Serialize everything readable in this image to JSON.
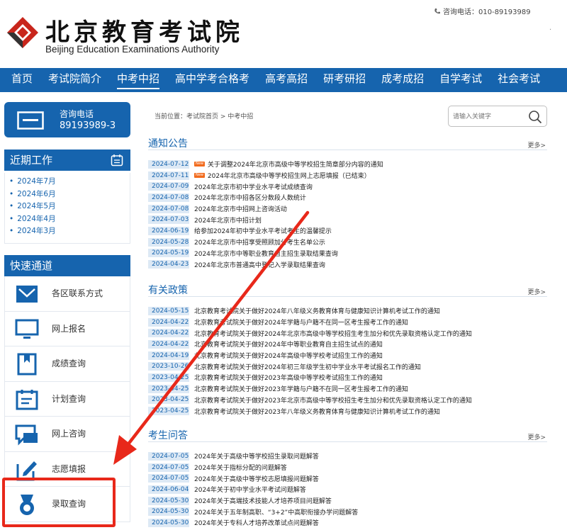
{
  "header": {
    "logo_cn": "北京教育考试院",
    "logo_en": "Beijing Education Examinations Authority",
    "hotline": "咨询电话：010-89193989",
    "dot": "."
  },
  "nav": {
    "items": [
      "首页",
      "考试院简介",
      "中考中招",
      "高中学考合格考",
      "高考高招",
      "研考研招",
      "成考成招",
      "自学考试",
      "社会考试"
    ],
    "active": "中考中招"
  },
  "sidebar": {
    "hotline_label": "咨询电话",
    "hotline_number": "89193989-3",
    "recent_title": "近期工作",
    "recent_items": [
      "2024年7月",
      "2024年6月",
      "2024年5月",
      "2024年4月",
      "2024年3月"
    ],
    "quick_title": "快速通道",
    "quick_items": [
      {
        "label": "各区联系方式",
        "icon": "envelope-icon"
      },
      {
        "label": "网上报名",
        "icon": "monitor-icon"
      },
      {
        "label": "成绩查询",
        "icon": "bookmark-icon"
      },
      {
        "label": "计划查询",
        "icon": "calendar-icon"
      },
      {
        "label": "网上咨询",
        "icon": "chat-icon"
      },
      {
        "label": "志愿填报",
        "icon": "edit-icon"
      },
      {
        "label": "录取查询",
        "icon": "medal-icon"
      }
    ]
  },
  "main": {
    "breadcrumb": "当前位置：考试院首页 > 中考中招",
    "search_placeholder": "请输入关键字",
    "more_label": "更多>",
    "new_badge": "New",
    "sections": [
      {
        "title": "通知公告",
        "items": [
          {
            "date": "2024-07-12",
            "new": true,
            "title": "关于调整2024年北京市高级中等学校招生简章部分内容的通知"
          },
          {
            "date": "2024-07-11",
            "new": true,
            "title": "2024年北京市高级中等学校招生网上志愿填报（已结束）"
          },
          {
            "date": "2024-07-09",
            "new": false,
            "title": "2024年北京市初中学业水平考试成绩查询"
          },
          {
            "date": "2024-07-08",
            "new": false,
            "title": "2024年北京市中招各区分数段人数统计"
          },
          {
            "date": "2024-07-08",
            "new": false,
            "title": "2024年北京市中招网上咨询活动"
          },
          {
            "date": "2024-07-03",
            "new": false,
            "title": "2024年北京市中招计划"
          },
          {
            "date": "2024-06-19",
            "new": false,
            "title": "给参加2024年初中学业水平考试考生的温馨提示"
          },
          {
            "date": "2024-05-28",
            "new": false,
            "title": "2024年北京市中招享受照顾加分考生名单公示"
          },
          {
            "date": "2024-05-19",
            "new": false,
            "title": "2024年北京市中等职业教育自主招生录取结果查询"
          },
          {
            "date": "2024-04-23",
            "new": false,
            "title": "2024年北京市普通高中登记入学录取结果查询"
          }
        ]
      },
      {
        "title": "有关政策",
        "items": [
          {
            "date": "2024-05-15",
            "new": false,
            "title": "北京教育考试院关于做好2024年八年级义务教育体育与健康知识计算机考试工作的通知"
          },
          {
            "date": "2024-04-22",
            "new": false,
            "title": "北京教育考试院关于做好2024年学籍与户籍不在同一区考生报考工作的通知"
          },
          {
            "date": "2024-04-22",
            "new": false,
            "title": "北京教育考试院关于做好2024年北京市高级中等学校招生考生加分和优先录取资格认定工作的通知"
          },
          {
            "date": "2024-04-22",
            "new": false,
            "title": "北京教育考试院关于做好2024年中等职业教育自主招生试点的通知"
          },
          {
            "date": "2024-04-19",
            "new": false,
            "title": "北京教育考试院关于做好2024年高级中等学校考试招生工作的通知"
          },
          {
            "date": "2023-10-26",
            "new": false,
            "title": "北京教育考试院关于做好2024年初三年级学生初中学业水平考试报名工作的通知"
          },
          {
            "date": "2023-04-25",
            "new": false,
            "title": "北京教育考试院关于做好2023年高级中等学校考试招生工作的通知"
          },
          {
            "date": "2023-04-25",
            "new": false,
            "title": "北京教育考试院关于做好2023年学籍与户籍不在同一区考生报考工作的通知"
          },
          {
            "date": "2023-04-25",
            "new": false,
            "title": "北京教育考试院关于做好2023年北京市高级中等学校招生考生加分和优先录取资格认定工作的通知"
          },
          {
            "date": "2023-04-25",
            "new": false,
            "title": "北京教育考试院关于做好2023年八年级义务教育体育与健康知识计算机考试工作的通知"
          }
        ]
      },
      {
        "title": "考生问答",
        "items": [
          {
            "date": "2024-07-05",
            "new": false,
            "title": "2024年关于高级中等学校招生录取问题解答"
          },
          {
            "date": "2024-07-05",
            "new": false,
            "title": "2024年关于指标分配的问题解答"
          },
          {
            "date": "2024-07-05",
            "new": false,
            "title": "2024年关于高级中等学校志愿填报问题解答"
          },
          {
            "date": "2024-06-04",
            "new": false,
            "title": "2024年关于初中学业水平考试问题解答"
          },
          {
            "date": "2024-05-30",
            "new": false,
            "title": "2024年关于高端技术技能人才培养项目问题解答"
          },
          {
            "date": "2024-05-30",
            "new": false,
            "title": "2024年关于五年制高职、“3+2”中高职衔接办学问题解答"
          },
          {
            "date": "2024-05-30",
            "new": false,
            "title": "2024年关于专科人才培养改革试点问题解答"
          }
        ]
      }
    ]
  },
  "colors": {
    "primary": "#1664ae",
    "date_bg": "#dde9f5",
    "new_badge": "#f26b1d",
    "annotation_red": "#e8281a",
    "logo_red": "#c8261c"
  }
}
